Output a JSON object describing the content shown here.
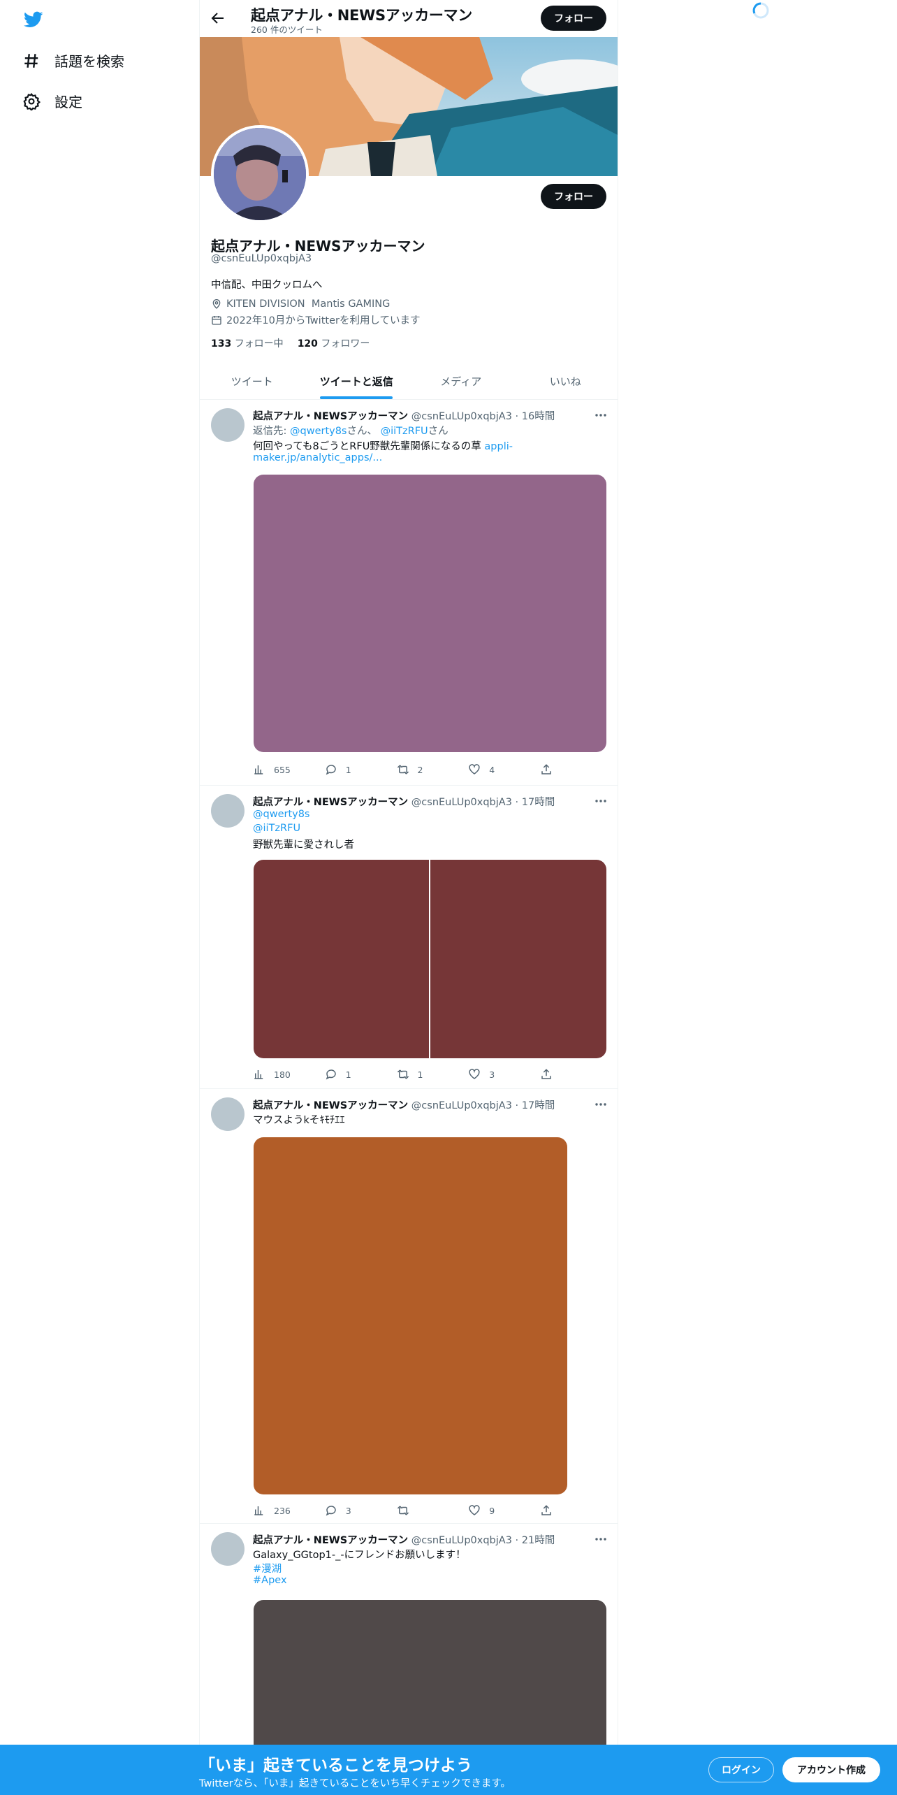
{
  "nav": {
    "logo": "twitter-bird-icon",
    "items": [
      {
        "icon": "hashtag-icon",
        "label": "話題を検索"
      },
      {
        "icon": "gear-icon",
        "label": "設定"
      }
    ]
  },
  "header": {
    "title": "起点アナル・NEWSアッカーマン",
    "tweet_count": "260 件のツイート",
    "follow_label": "フォロー"
  },
  "profile": {
    "name": "起点アナル・NEWSアッカーマン",
    "handle": "@csnEuLUp0xqbjA3",
    "follow_label": "フォロー",
    "bio": "中信配、中田クッロムへ",
    "location": "KITEN DIVISION  Mantis GAMING",
    "joined": "2022年10月からTwitterを利用しています",
    "following_count": "133",
    "following_label": "フォロー中",
    "followers_count": "120",
    "followers_label": "フォロワー"
  },
  "tabs": [
    {
      "label": "ツイート",
      "active": false
    },
    {
      "label": "ツイートと返信",
      "active": true
    },
    {
      "label": "メディア",
      "active": false
    },
    {
      "label": "いいね",
      "active": false
    }
  ],
  "tweets": [
    {
      "name": "起点アナル・NEWSアッカーマン",
      "handle_time": "@csnEuLUp0xqbjA3 · 16時間",
      "reply_prefix": "返信先: ",
      "reply_user1": "@qwerty8s",
      "reply_mid": "さん、",
      "reply_user2": "@iiTzRFU",
      "reply_suffix": "さん",
      "text": "何回やっても8ごうとRFU野獣先輩関係になるの草 ",
      "link1": "appli-",
      "link2": "maker.jp/analytic_apps/...",
      "media_color": "#93668a",
      "views": "655",
      "replies": "1",
      "retweets": "2",
      "likes": "4"
    },
    {
      "name": "起点アナル・NEWSアッカーマン",
      "handle_time": "@csnEuLUp0xqbjA3 · 17時間",
      "mention1": "@qwerty8s",
      "mention2": "@iiTzRFU",
      "text": "野獣先輩に愛されし者",
      "media_color": "#763637",
      "views": "180",
      "replies": "1",
      "retweets": "1",
      "likes": "3"
    },
    {
      "name": "起点アナル・NEWSアッカーマン",
      "handle_time": "@csnEuLUp0xqbjA3 · 17時間",
      "text": "マウスようkそｷﾓﾁｴｴ",
      "media_color": "#b25d28",
      "views": "236",
      "replies": "3",
      "retweets": "",
      "likes": "9"
    },
    {
      "name": "起点アナル・NEWSアッカーマン",
      "handle_time": "@csnEuLUp0xqbjA3 · 21時間",
      "text": "Galaxy_GGtop1-_-にフレンドお願いします！",
      "hashtag1": "#漫湖",
      "hashtag2": "#Apex",
      "media_color": "#504949"
    }
  ],
  "bottom_bar": {
    "title": "「いま」起きていることを見つけよう",
    "subtitle": "Twitterなら、「いま」起きていることをいち早くチェックできます。",
    "login_label": "ログイン",
    "signup_label": "アカウント作成"
  },
  "colors": {
    "accent": "#1d9bf0",
    "text": "#0f1419",
    "secondary": "#536471"
  }
}
